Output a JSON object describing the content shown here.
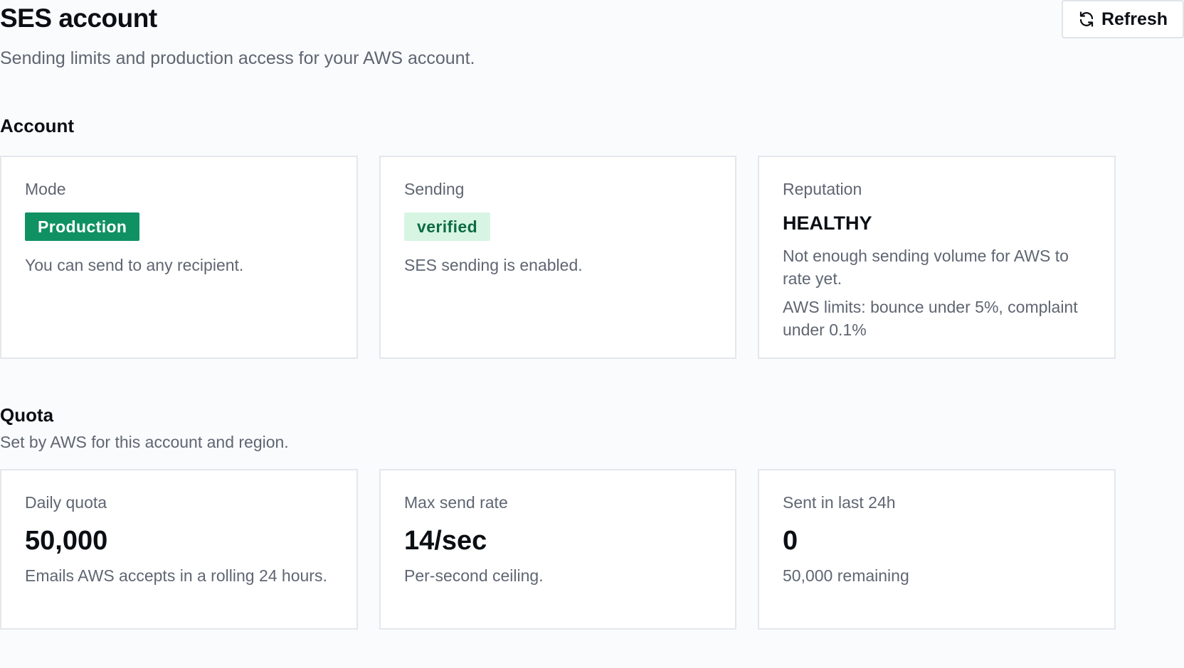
{
  "header": {
    "title": "SES account",
    "subtitle": "Sending limits and production access for your AWS account.",
    "refresh_label": "Refresh",
    "refresh_icon": "refresh-icon"
  },
  "account": {
    "title": "Account",
    "mode": {
      "label": "Mode",
      "badge": "Production",
      "badge_color": "#109164",
      "description": "You can send to any recipient."
    },
    "sending": {
      "label": "Sending",
      "badge": "verified",
      "badge_bg": "#d8f5e3",
      "badge_color": "#0d6b45",
      "description": "SES sending is enabled."
    },
    "reputation": {
      "label": "Reputation",
      "value": "HEALTHY",
      "description": "Not enough sending volume for AWS to rate yet.",
      "limits": "AWS limits: bounce under 5%, complaint under 0.1%"
    }
  },
  "quota": {
    "title": "Quota",
    "subtitle": "Set by AWS for this account and region.",
    "daily": {
      "label": "Daily quota",
      "value": "50,000",
      "description": "Emails AWS accepts in a rolling 24 hours."
    },
    "rate": {
      "label": "Max send rate",
      "value": "14/sec",
      "description": "Per-second ceiling."
    },
    "sent": {
      "label": "Sent in last 24h",
      "value": "0",
      "description": "50,000 remaining"
    }
  }
}
